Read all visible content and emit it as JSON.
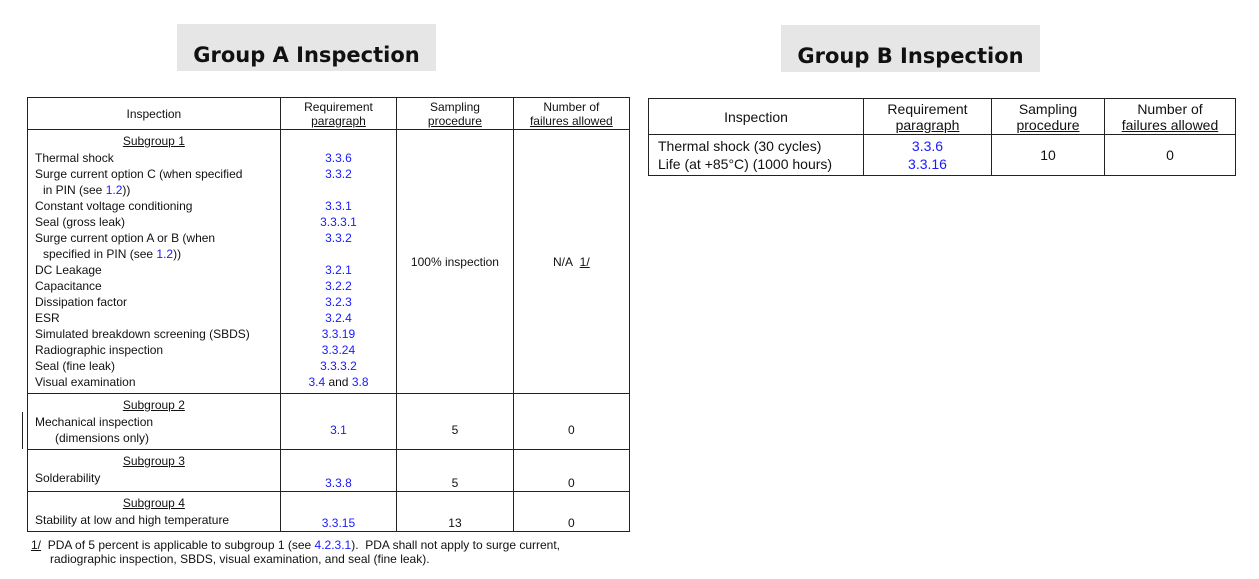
{
  "group_a": {
    "title": "Group A Inspection",
    "headers": {
      "inspection": "Inspection",
      "requirement_l1": "Requirement",
      "requirement_l2": "paragraph",
      "sampling_l1": "Sampling",
      "sampling_l2": "procedure",
      "failures_l1": "Number of",
      "failures_l2": "failures allowed"
    },
    "subgroup1": {
      "title": "Subgroup 1",
      "sampling": "100% inspection",
      "failures": "N/A",
      "failures_note": "1/",
      "items": [
        {
          "text": "Thermal shock",
          "ref": "3.3.6"
        },
        {
          "text": "Surge current option C (when specified",
          "text2_pre": "in PIN (see ",
          "text2_link": "1.2",
          "text2_post": "))",
          "ref": "3.3.2"
        },
        {
          "text": "Constant voltage conditioning",
          "ref": "3.3.1"
        },
        {
          "text": "Seal (gross leak)",
          "ref": "3.3.3.1"
        },
        {
          "text": "Surge current option A or B (when",
          "text2_pre": "specified in PIN (see ",
          "text2_link": "1.2",
          "text2_post": "))",
          "ref": "3.3.2"
        },
        {
          "text": "DC Leakage",
          "ref": "3.2.1"
        },
        {
          "text": "Capacitance",
          "ref": "3.2.2"
        },
        {
          "text": "Dissipation factor",
          "ref": "3.2.3"
        },
        {
          "text": "ESR",
          "ref": "3.2.4"
        },
        {
          "text": "Simulated breakdown screening (SBDS)",
          "ref": "3.3.19"
        },
        {
          "text": "Radiographic inspection",
          "ref": "3.3.24"
        },
        {
          "text": "Seal (fine leak)",
          "ref": "3.3.3.2"
        },
        {
          "text": "Visual examination",
          "ref": "3.4",
          "ref_joiner": " and ",
          "ref2": "3.8"
        }
      ]
    },
    "subgroup2": {
      "title": "Subgroup 2",
      "item_l1": "Mechanical inspection",
      "item_l2": "(dimensions only)",
      "ref": "3.1",
      "sampling": "5",
      "failures": "0"
    },
    "subgroup3": {
      "title": "Subgroup 3",
      "item": "Solderability",
      "ref": "3.3.8",
      "sampling": "5",
      "failures": "0"
    },
    "subgroup4": {
      "title": "Subgroup 4",
      "item": "Stability at low and high temperature",
      "ref": "3.3.15",
      "sampling": "13",
      "failures": "0"
    },
    "footnote": {
      "marker": "1/",
      "line1_pre": "PDA of 5 percent is applicable to subgroup 1 (see ",
      "line1_link": "4.2.3.1",
      "line1_post": ").  PDA shall not apply to surge current,",
      "line2": "radiographic inspection, SBDS, visual examination, and seal (fine leak)."
    }
  },
  "group_b": {
    "title": "Group B Inspection",
    "headers": {
      "inspection": "Inspection",
      "requirement_l1": "Requirement",
      "requirement_l2": "paragraph",
      "sampling_l1": "Sampling",
      "sampling_l2": "procedure",
      "failures_l1": "Number of",
      "failures_l2": "failures allowed"
    },
    "items": [
      {
        "text": "Thermal shock (30 cycles)",
        "ref": "3.3.6"
      },
      {
        "text": "Life (at +85°C) (1000 hours)",
        "ref": "3.3.16"
      }
    ],
    "sampling": "10",
    "failures": "0"
  }
}
